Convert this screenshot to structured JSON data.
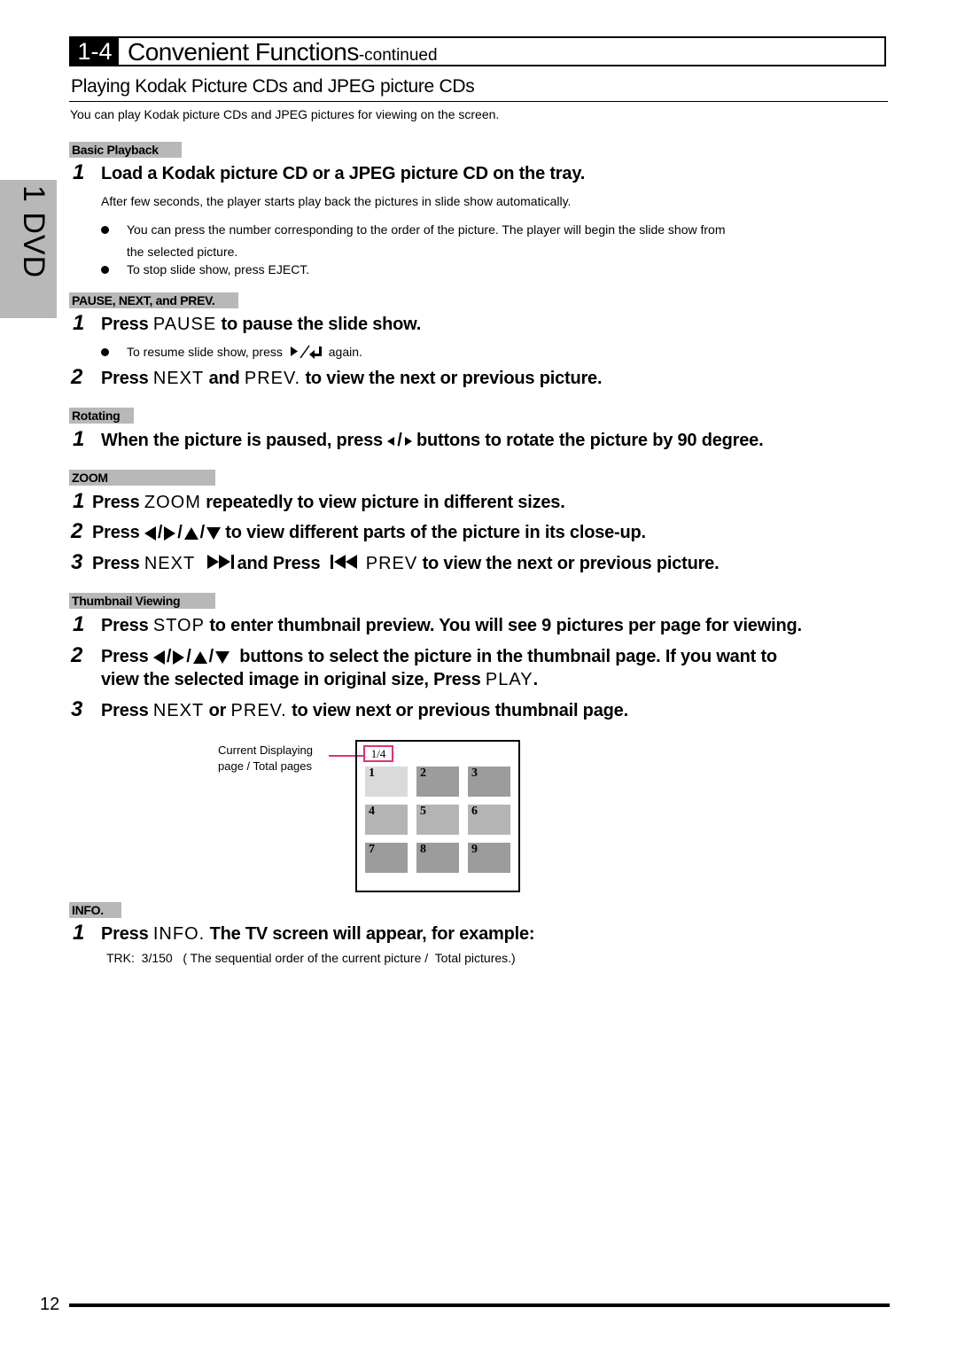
{
  "header": {
    "section_number": "1-4",
    "title": "Convenient Functions",
    "title_suffix": "-continued"
  },
  "side_tab": "1 DVD",
  "subtitle": "Playing Kodak Picture CDs and JPEG picture CDs",
  "intro": "You can play Kodak picture CDs and JPEG pictures for viewing on the screen.",
  "sections": {
    "basic": {
      "tag": "Basic Playback",
      "step1": {
        "num": "1",
        "text": "Load a Kodak picture CD or a JPEG picture CD on the tray."
      },
      "desc": "After few seconds, the player starts play back the pictures in slide show automatically.",
      "bullet1_line1": "You can press the number corresponding to the order of the picture. The player will  begin the slide show from",
      "bullet1_line2": "the selected picture.",
      "bullet2": "To stop slide show, press EJECT."
    },
    "pause": {
      "tag": "PAUSE, NEXT, and PREV.",
      "step1": {
        "num": "1",
        "pre": "Press",
        "key": "PAUSE",
        "post": "to pause the slide show."
      },
      "bullet_pre": "To resume slide show, press",
      "bullet_icon": "play-enter-icon",
      "bullet_post": "again.",
      "step2": {
        "num": "2",
        "pre": "Press",
        "key1": "NEXT",
        "mid": "and",
        "key2": "PREV.",
        "post": "to view the next or previous picture."
      }
    },
    "rotating": {
      "tag": "Rotating",
      "step1": {
        "num": "1",
        "pre": "When the picture is paused, press",
        "sep": "/",
        "post": "buttons to rotate the picture by 90 degree."
      }
    },
    "zoom": {
      "tag": "ZOOM",
      "step1": {
        "num": "1",
        "pre": "Press",
        "key": "ZOOM",
        "post": "repeatedly to view picture in different sizes."
      },
      "step2": {
        "num": "2",
        "pre": "Press",
        "sep": "/",
        "post": "to view different parts of the picture in its close-up."
      },
      "step3": {
        "num": "3",
        "pre": "Press",
        "key1": "NEXT",
        "mid": "and Press",
        "key2": "PREV",
        "post": "to view the next or previous picture."
      }
    },
    "thumbnail": {
      "tag": "Thumbnail Viewing",
      "step1": {
        "num": "1",
        "pre": "Press",
        "key": "STOP",
        "post": "to enter thumbnail preview. You will see 9 pictures per page for viewing."
      },
      "step2": {
        "num": "2",
        "pre": "Press",
        "sep": "/",
        "post": "buttons to select the picture in the thumbnail page. If you want to",
        "line2_pre": "view the selected image in original size, Press",
        "line2_key": "PLAY",
        "line2_post": "."
      },
      "step3": {
        "num": "3",
        "pre": "Press",
        "key1": "NEXT",
        "mid": "or",
        "key2": "PREV.",
        "post": "to view next or previous thumbnail page."
      },
      "diagram": {
        "callout_line1": "Current Displaying",
        "callout_line2": "page / Total pages",
        "page_indicator": "1/4",
        "cells": [
          "1",
          "2",
          "3",
          "4",
          "5",
          "6",
          "7",
          "8",
          "9"
        ],
        "selected_cell": "1",
        "highlight_color": "#e0307a"
      }
    },
    "info": {
      "tag": "INFO.",
      "step1": {
        "num": "1",
        "pre": "Press",
        "key": "INFO.",
        "post": "The TV screen will appear, for example:"
      },
      "example": "TRK:  3/150   ( The sequential order of the current picture /  Total pictures.)"
    }
  },
  "footer": {
    "page_number": "12"
  }
}
